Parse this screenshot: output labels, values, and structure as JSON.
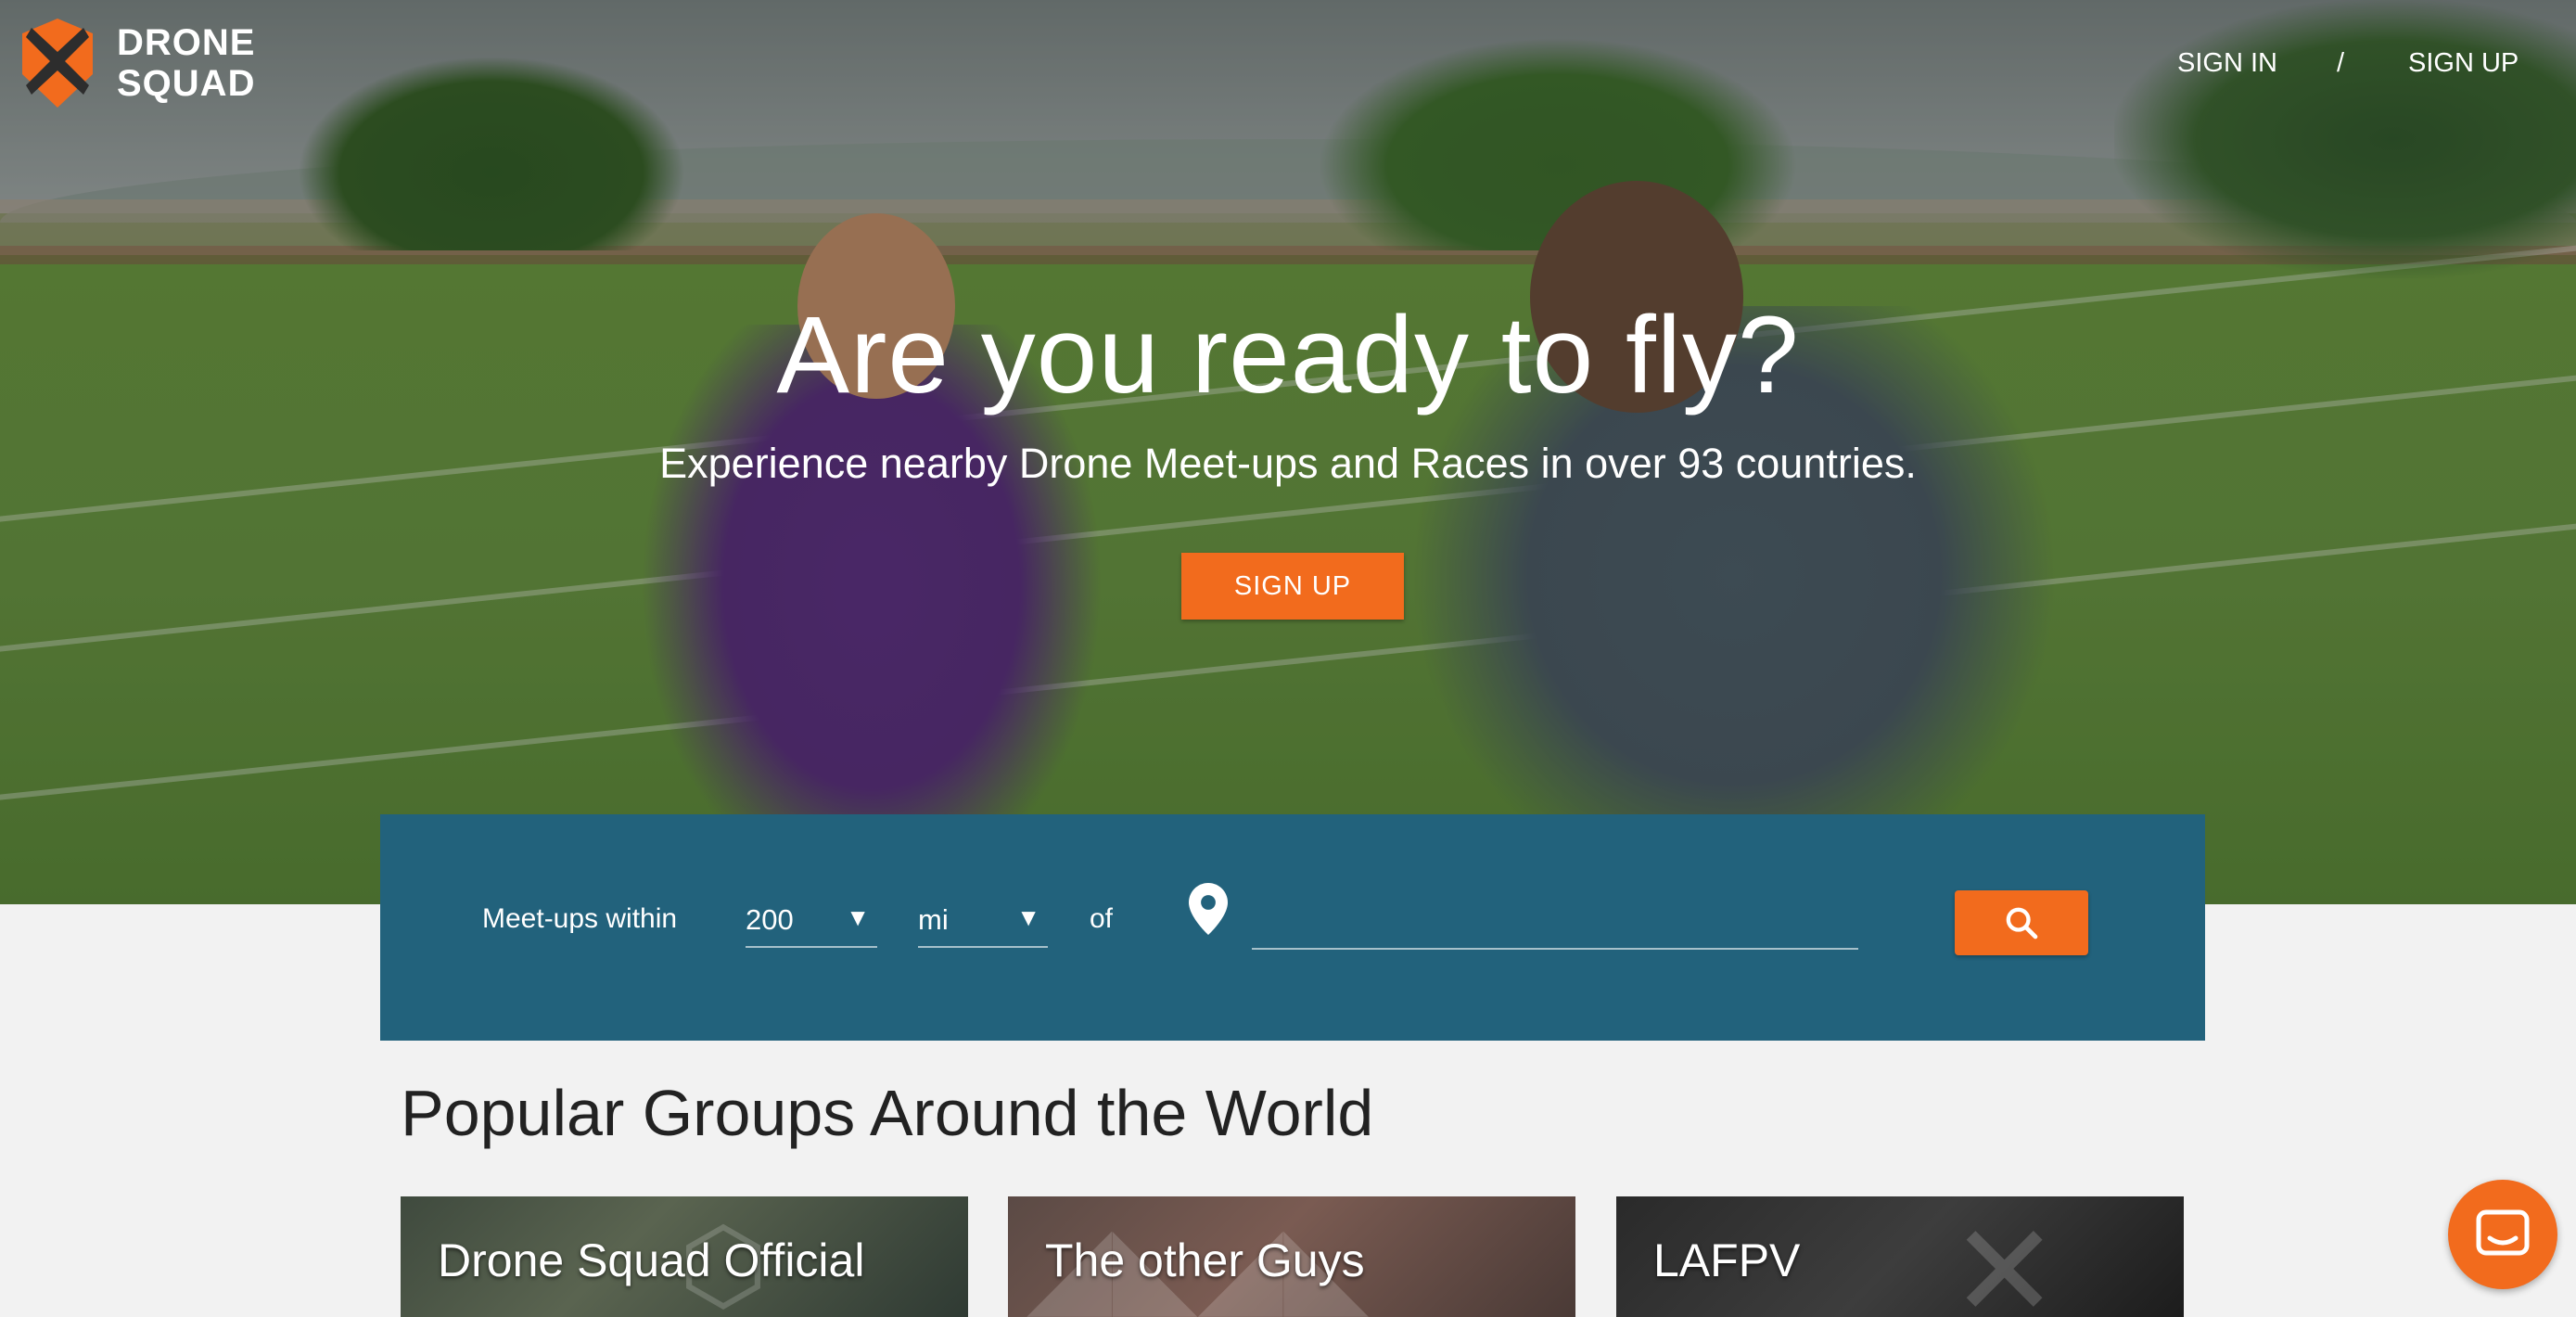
{
  "brand": {
    "line1": "DRONE",
    "line2": "SQUAD",
    "accent": "#f26b1d",
    "dark": "#2d2d2d"
  },
  "nav": {
    "sign_in": "SIGN IN",
    "separator": "/",
    "sign_up": "SIGN UP"
  },
  "hero": {
    "headline": "Are you ready to fly?",
    "subheadline": "Experience nearby Drone Meet-ups and Races in over 93 countries.",
    "cta_label": "SIGN UP"
  },
  "search": {
    "label": "Meet-ups within",
    "distance_value": "200",
    "unit_value": "mi",
    "of_label": "of",
    "location_value": "",
    "panel_color": "#22627c",
    "icons": [
      "location-pin-icon",
      "search-icon",
      "chevron-down-icon"
    ]
  },
  "popular": {
    "title": "Popular Groups Around the World",
    "groups": [
      {
        "name": "Drone Squad Official"
      },
      {
        "name": "The other Guys"
      },
      {
        "name": "LAFPV"
      }
    ]
  },
  "chat": {
    "icon": "chat-icon"
  }
}
